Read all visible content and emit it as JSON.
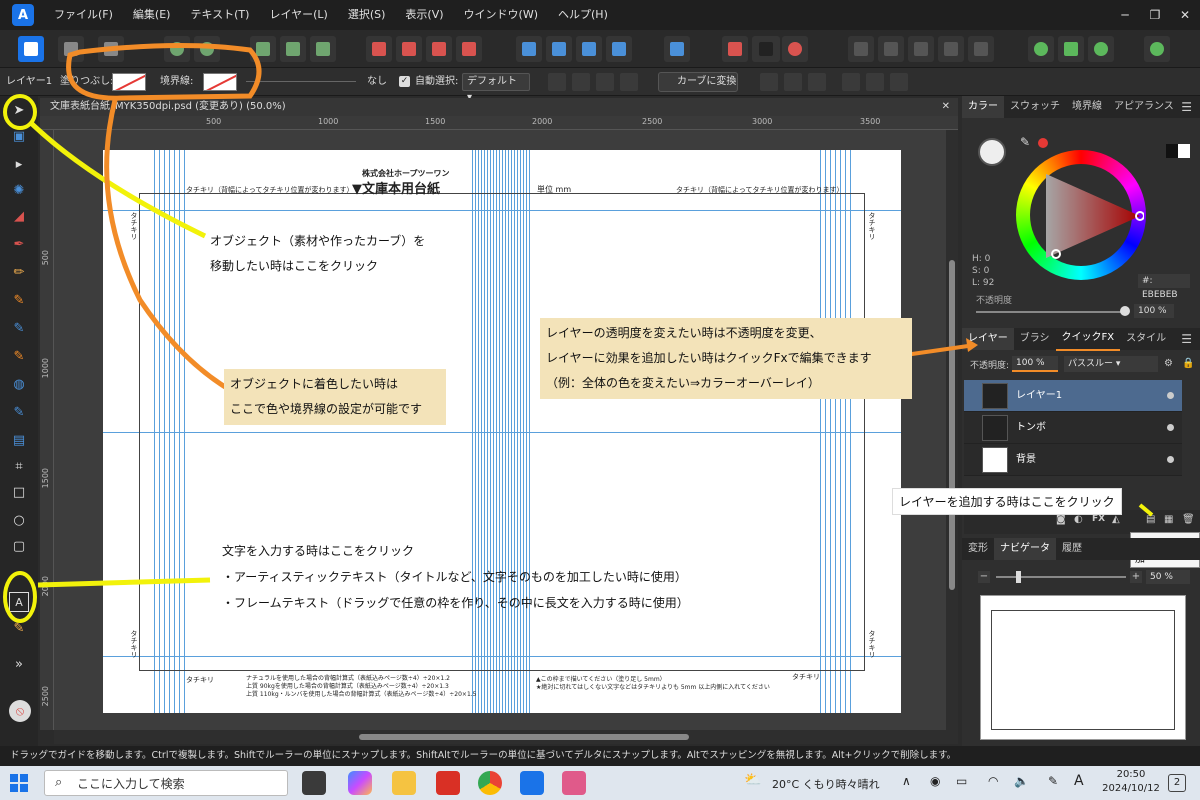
{
  "menubar": {
    "items": [
      "ファイル(F)",
      "編集(E)",
      "テキスト(T)",
      "レイヤー(L)",
      "選択(S)",
      "表示(V)",
      "ウインドウ(W)",
      "ヘルプ(H)"
    ]
  },
  "context_bar": {
    "layer_label": "レイヤー1",
    "fill_label": "塗りつぶし:",
    "stroke_label": "境界線:",
    "stroke_none": "なし",
    "auto_select_label": "自動選択:",
    "auto_select_value": "デフォルト",
    "convert_curves": "カーブに変換"
  },
  "document": {
    "tab_title": "文庫表紙台紙_MYK350dpi.psd (変更あり) (50.0%)",
    "ruler_top": [
      "500",
      "1000",
      "1500",
      "2000",
      "2500",
      "3000",
      "3500"
    ],
    "ruler_left": [
      "500",
      "1000",
      "1500",
      "2000",
      "2500"
    ],
    "company": "株式会社ホープツーワン",
    "title": "▼文庫本用台紙",
    "unit": "単位 mm",
    "tachikiri": "タチキリ",
    "tachikiri_note": "タチキリ（背幅によってタチキリ位置が変わります）",
    "bottom_left_1": "ナチュラルを使用した場合の背幅計算式（表紙込みページ数÷4）÷20×1.2",
    "bottom_left_2": "上質 90kgを使用した場合の背幅計算式（表紙込みページ数÷4）÷20×1.3",
    "bottom_left_3": "上質 110kg・ルンバを使用した場合の背幅計算式（表紙込みページ数÷4）÷20×1.5",
    "bottom_right_1": "▲この枠まで描いてください（塗り足し 5mm）",
    "bottom_right_2": "★絶対に切れてはしくない文字などはタチキリよりも 5mm 以上内側に入れてください"
  },
  "color_panel": {
    "tabs": [
      "カラー",
      "スウォッチ",
      "境界線",
      "アピアランス"
    ],
    "h": "H: 0",
    "s": "S: 0",
    "l": "L: 92",
    "hex": "#: EBEBEB",
    "opacity_label": "不透明度",
    "opacity_value": "100 %"
  },
  "layers_panel": {
    "tabs": [
      "レイヤー",
      "ブラシ",
      "クイックFX",
      "スタイル"
    ],
    "opacity_label": "不透明度:",
    "opacity_value": "100 %",
    "blend_mode": "パススルー",
    "layers": [
      {
        "name": "レイヤー1",
        "selected": true
      },
      {
        "name": "トンボ",
        "selected": false
      },
      {
        "name": "背景",
        "selected": false
      }
    ],
    "add_layer_tooltip": "レイヤーを追加"
  },
  "nav_panel": {
    "tabs": [
      "変形",
      "ナビゲータ",
      "履歴"
    ],
    "zoom": "50 %"
  },
  "statusbar": {
    "text": "ドラッグでガイドを移動します。Ctrlで複製します。Shiftでルーラーの単位にスナップします。ShiftAltでルーラーの単位に基づいてデルタにスナップします。Altでスナッピングを無視します。Alt+クリックで削除します。"
  },
  "taskbar": {
    "search_placeholder": "ここに入力して検索",
    "weather": "20°C くもり時々晴れ",
    "time": "20:50",
    "date": "2024/10/12",
    "ime": "A",
    "notif": "2"
  },
  "annotations": {
    "move_1": "オブジェクト（素材や作ったカーブ）を",
    "move_2": "移動したい時はここをクリック",
    "color_1": "オブジェクトに着色したい時は",
    "color_2": "ここで色や境界線の設定が可能です",
    "layer_1": "レイヤーの透明度を変えたい時は不透明度を変更、",
    "layer_2": "レイヤーに効果を追加したい時はクイックFxで編集できます",
    "layer_3": "（例：全体の色を変えたい⇒カラーオーバーレイ）",
    "add_layer": "レイヤーを追加する時はここをクリック",
    "text_1": "文字を入力する時はここをクリック",
    "text_2": "・アーティスティックテキスト（タイトルなど、文字そのものを加工したい時に使用）",
    "text_3": "・フレームテキスト（ドラッグで任意の枠を作り、その中に長文を入力する時に使用）"
  },
  "colors": {
    "accent": "#1a73e8",
    "annotation_bg": "#f3e3b9",
    "highlight_yellow": "#f2f20a",
    "highlight_orange": "#f28c28",
    "guide": "#5aa0dc"
  }
}
